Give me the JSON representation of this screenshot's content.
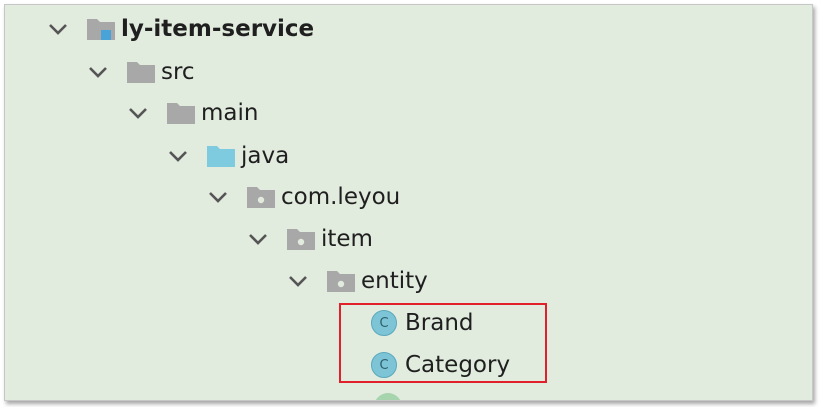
{
  "tree": {
    "module": "ly-item-service",
    "src": "src",
    "main": "main",
    "java": "java",
    "package_com": "com.leyou",
    "package_item": "item",
    "package_entity": "entity",
    "classes": [
      {
        "name": "Brand",
        "icon_letter": "C"
      },
      {
        "name": "Category",
        "icon_letter": "C"
      }
    ]
  },
  "icons": {
    "module": "module-folder-icon",
    "folder": "folder-icon",
    "source_root": "source-root-folder-icon",
    "package": "package-folder-icon",
    "class": "class-icon",
    "expanded": "chevron-down-icon"
  },
  "colors": {
    "background": "#e1ebde",
    "folder_gray": "#a8a8a8",
    "source_folder_blue": "#7ecbe0",
    "class_icon": "#7dc4d6",
    "highlight_border": "#e0202a"
  }
}
